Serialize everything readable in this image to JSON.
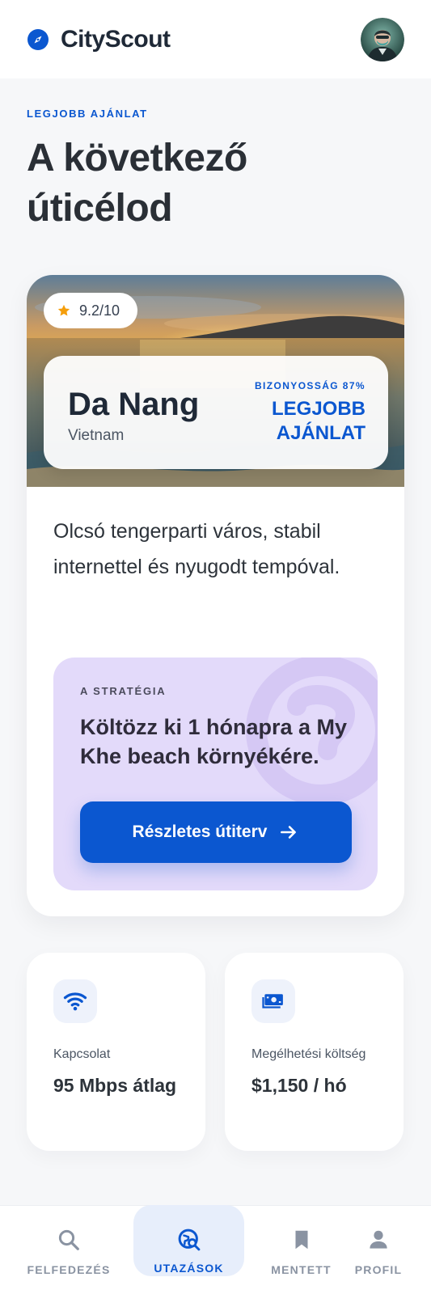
{
  "app": {
    "name": "CityScout"
  },
  "hero": {
    "eyebrow": "LEGJOBB AJÁNLAT",
    "title": "A következő úticélod"
  },
  "destination": {
    "rating": "9.2/10",
    "city": "Da Nang",
    "country": "Vietnam",
    "confidence": "BIZONYOSSÁG 87%",
    "verdict": "LEGJOBB AJÁNLAT",
    "description": "Olcsó tengerparti város, stabil internettel és nyugodt tempóval."
  },
  "strategy": {
    "label": "A STRATÉGIA",
    "text": "Költözz ki 1 hónapra a My Khe beach környékére.",
    "cta_label": "Részletes útiterv"
  },
  "stats": [
    {
      "icon": "wifi-icon",
      "label": "Kapcsolat",
      "value": "95 Mbps átlag"
    },
    {
      "icon": "cash-icon",
      "label": "Megélhetési költség",
      "value": "$1,150 / hó"
    }
  ],
  "nav": {
    "items": [
      {
        "icon": "search-icon",
        "label": "FELFEDEZÉS",
        "active": false
      },
      {
        "icon": "travel-explore-icon",
        "label": "UTAZÁSOK",
        "active": true
      },
      {
        "icon": "bookmark-icon",
        "label": "MENTETT",
        "active": false
      },
      {
        "icon": "person-icon",
        "label": "PROFIL",
        "active": false
      }
    ]
  },
  "colors": {
    "accent": "#0b57d0",
    "background": "#f6f7f9",
    "strategy_bg": "#e3dafa",
    "star": "#f59e0b"
  }
}
